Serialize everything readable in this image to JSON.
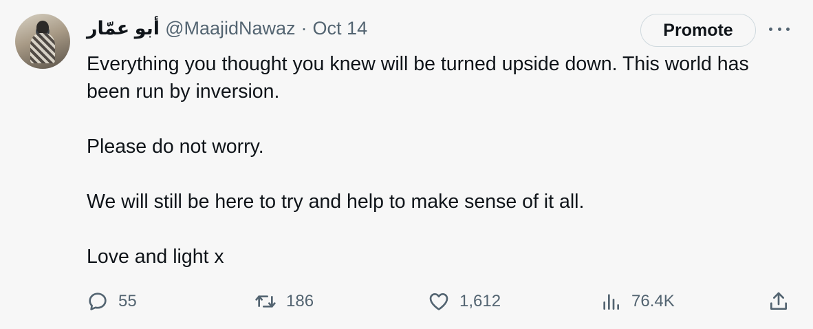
{
  "tweet": {
    "display_name": "أبو عمّار",
    "handle": "@MaajidNawaz",
    "separator": "·",
    "date": "Oct 14",
    "promote_label": "Promote",
    "paragraphs": [
      "Everything you thought you knew will be turned upside down. This world has been run by inversion.",
      "Please do not worry.",
      "We will still be here to try and help to make sense of it all.",
      "Love and light x"
    ]
  },
  "actions": {
    "reply": {
      "icon": "reply-icon",
      "count": "55"
    },
    "retweet": {
      "icon": "retweet-icon",
      "count": "186"
    },
    "like": {
      "icon": "heart-icon",
      "count": "1,612"
    },
    "views": {
      "icon": "views-icon",
      "count": "76.4K"
    },
    "share": {
      "icon": "share-icon"
    }
  },
  "colors": {
    "background": "#f7f7f7",
    "text": "#0f1419",
    "secondary": "#536471",
    "border": "#cfd9de"
  }
}
